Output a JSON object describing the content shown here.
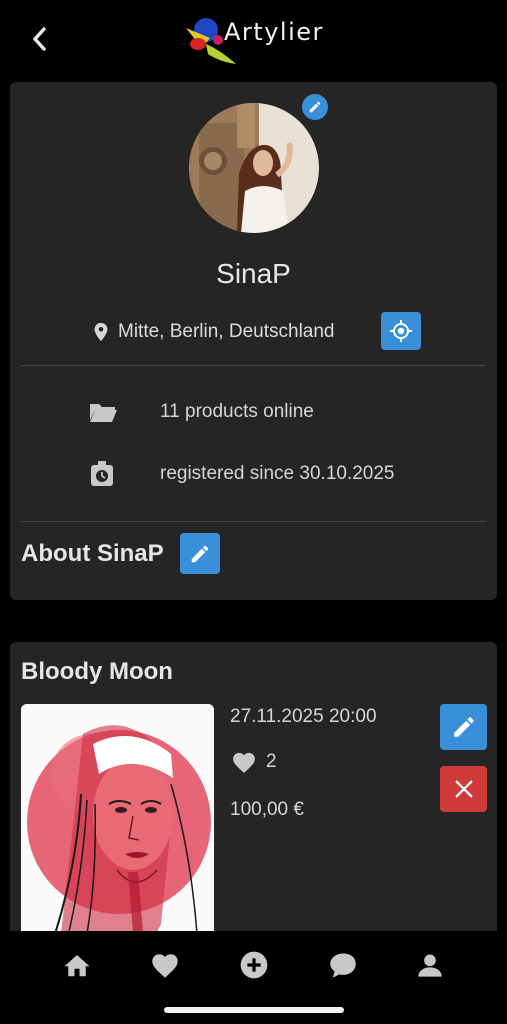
{
  "app": {
    "logo_text": "Artylier"
  },
  "profile": {
    "username": "SinaP",
    "location": "Mitte, Berlin, Deutschland",
    "products_online": "11 products online",
    "registered": "registered since 30.10.2025",
    "about_title": "About SinaP"
  },
  "product": {
    "title": "Bloody Moon",
    "date": "27.11.2025 20:00",
    "likes": "2",
    "price": "100,00 €"
  },
  "colors": {
    "background": "#000000",
    "card": "#252525",
    "accent_blue": "#3a8fd9",
    "danger_red": "#d13a3a"
  },
  "icons": {
    "back": "chevron-left-icon",
    "avatar_edit": "pencil-icon",
    "location": "map-pin-icon",
    "locate": "crosshair-icon",
    "products": "folder-icon",
    "registered": "clock-badge-icon",
    "about_edit": "pencil-icon",
    "likes": "heart-icon",
    "product_edit": "pencil-icon",
    "product_delete": "close-icon",
    "nav": [
      "home-icon",
      "heart-icon",
      "add-circle-icon",
      "chat-icon",
      "person-icon"
    ]
  }
}
